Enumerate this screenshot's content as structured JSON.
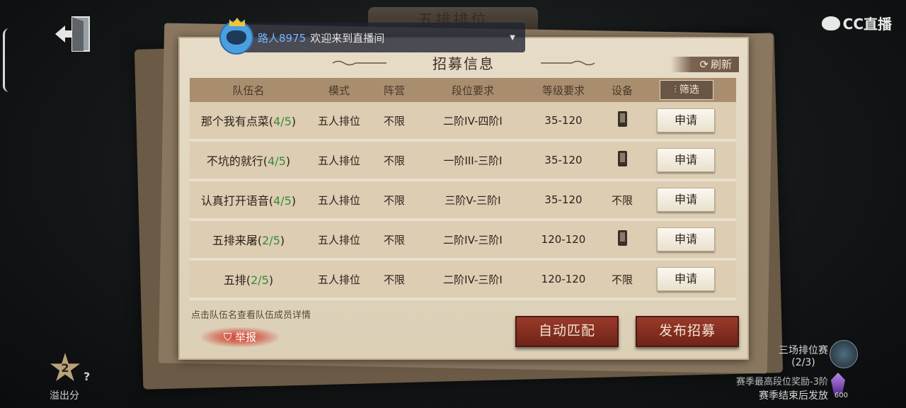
{
  "background": {
    "title": "五排排位"
  },
  "panel": {
    "title": "招募信息",
    "refresh_label": "刷新",
    "filter_label": "筛选",
    "columns": [
      "队伍名",
      "模式",
      "阵营",
      "段位要求",
      "等级要求",
      "设备"
    ],
    "rows": [
      {
        "name": "那个我有点菜",
        "count": "4/5",
        "mode": "五人排位",
        "camp": "不限",
        "rank": "二阶IV-四阶I",
        "level": "35-120",
        "device": "phone",
        "device_text": "",
        "apply": "申请"
      },
      {
        "name": "不坑的就行",
        "count": "4/5",
        "mode": "五人排位",
        "camp": "不限",
        "rank": "一阶III-三阶I",
        "level": "35-120",
        "device": "phone",
        "device_text": "",
        "apply": "申请"
      },
      {
        "name": "认真打开语音",
        "count": "4/5",
        "mode": "五人排位",
        "camp": "不限",
        "rank": "三阶V-三阶I",
        "level": "35-120",
        "device": "any",
        "device_text": "不限",
        "apply": "申请"
      },
      {
        "name": "五排来屠",
        "count": "2/5",
        "mode": "五人排位",
        "camp": "不限",
        "rank": "二阶IV-三阶I",
        "level": "120-120",
        "device": "phone",
        "device_text": "",
        "apply": "申请"
      },
      {
        "name": "五排",
        "count": "2/5",
        "mode": "五人排位",
        "camp": "不限",
        "rank": "二阶IV-三阶I",
        "level": "120-120",
        "device": "any",
        "device_text": "不限",
        "apply": "申请"
      }
    ],
    "hint": "点击队伍名查看队伍成员详情",
    "report_label": "举报",
    "auto_match_label": "自动匹配",
    "publish_label": "发布招募"
  },
  "stream": {
    "brand": "CC直播",
    "user": "路人8975",
    "message": "欢迎来到直播间"
  },
  "bottom_left": {
    "star_value": "2",
    "help": "?",
    "label": "溢出分"
  },
  "bottom_right": {
    "rank_match": "三场排位赛",
    "rank_progress": "(2/3)",
    "season_reward": "赛季最高段位奖励-3阶",
    "season_note": "赛季结束后发放",
    "gem_count": "600"
  },
  "colors": {
    "accent_button": "#8a2f22",
    "count_green": "#3a8a3a",
    "stream_user": "#6fb6ff"
  }
}
